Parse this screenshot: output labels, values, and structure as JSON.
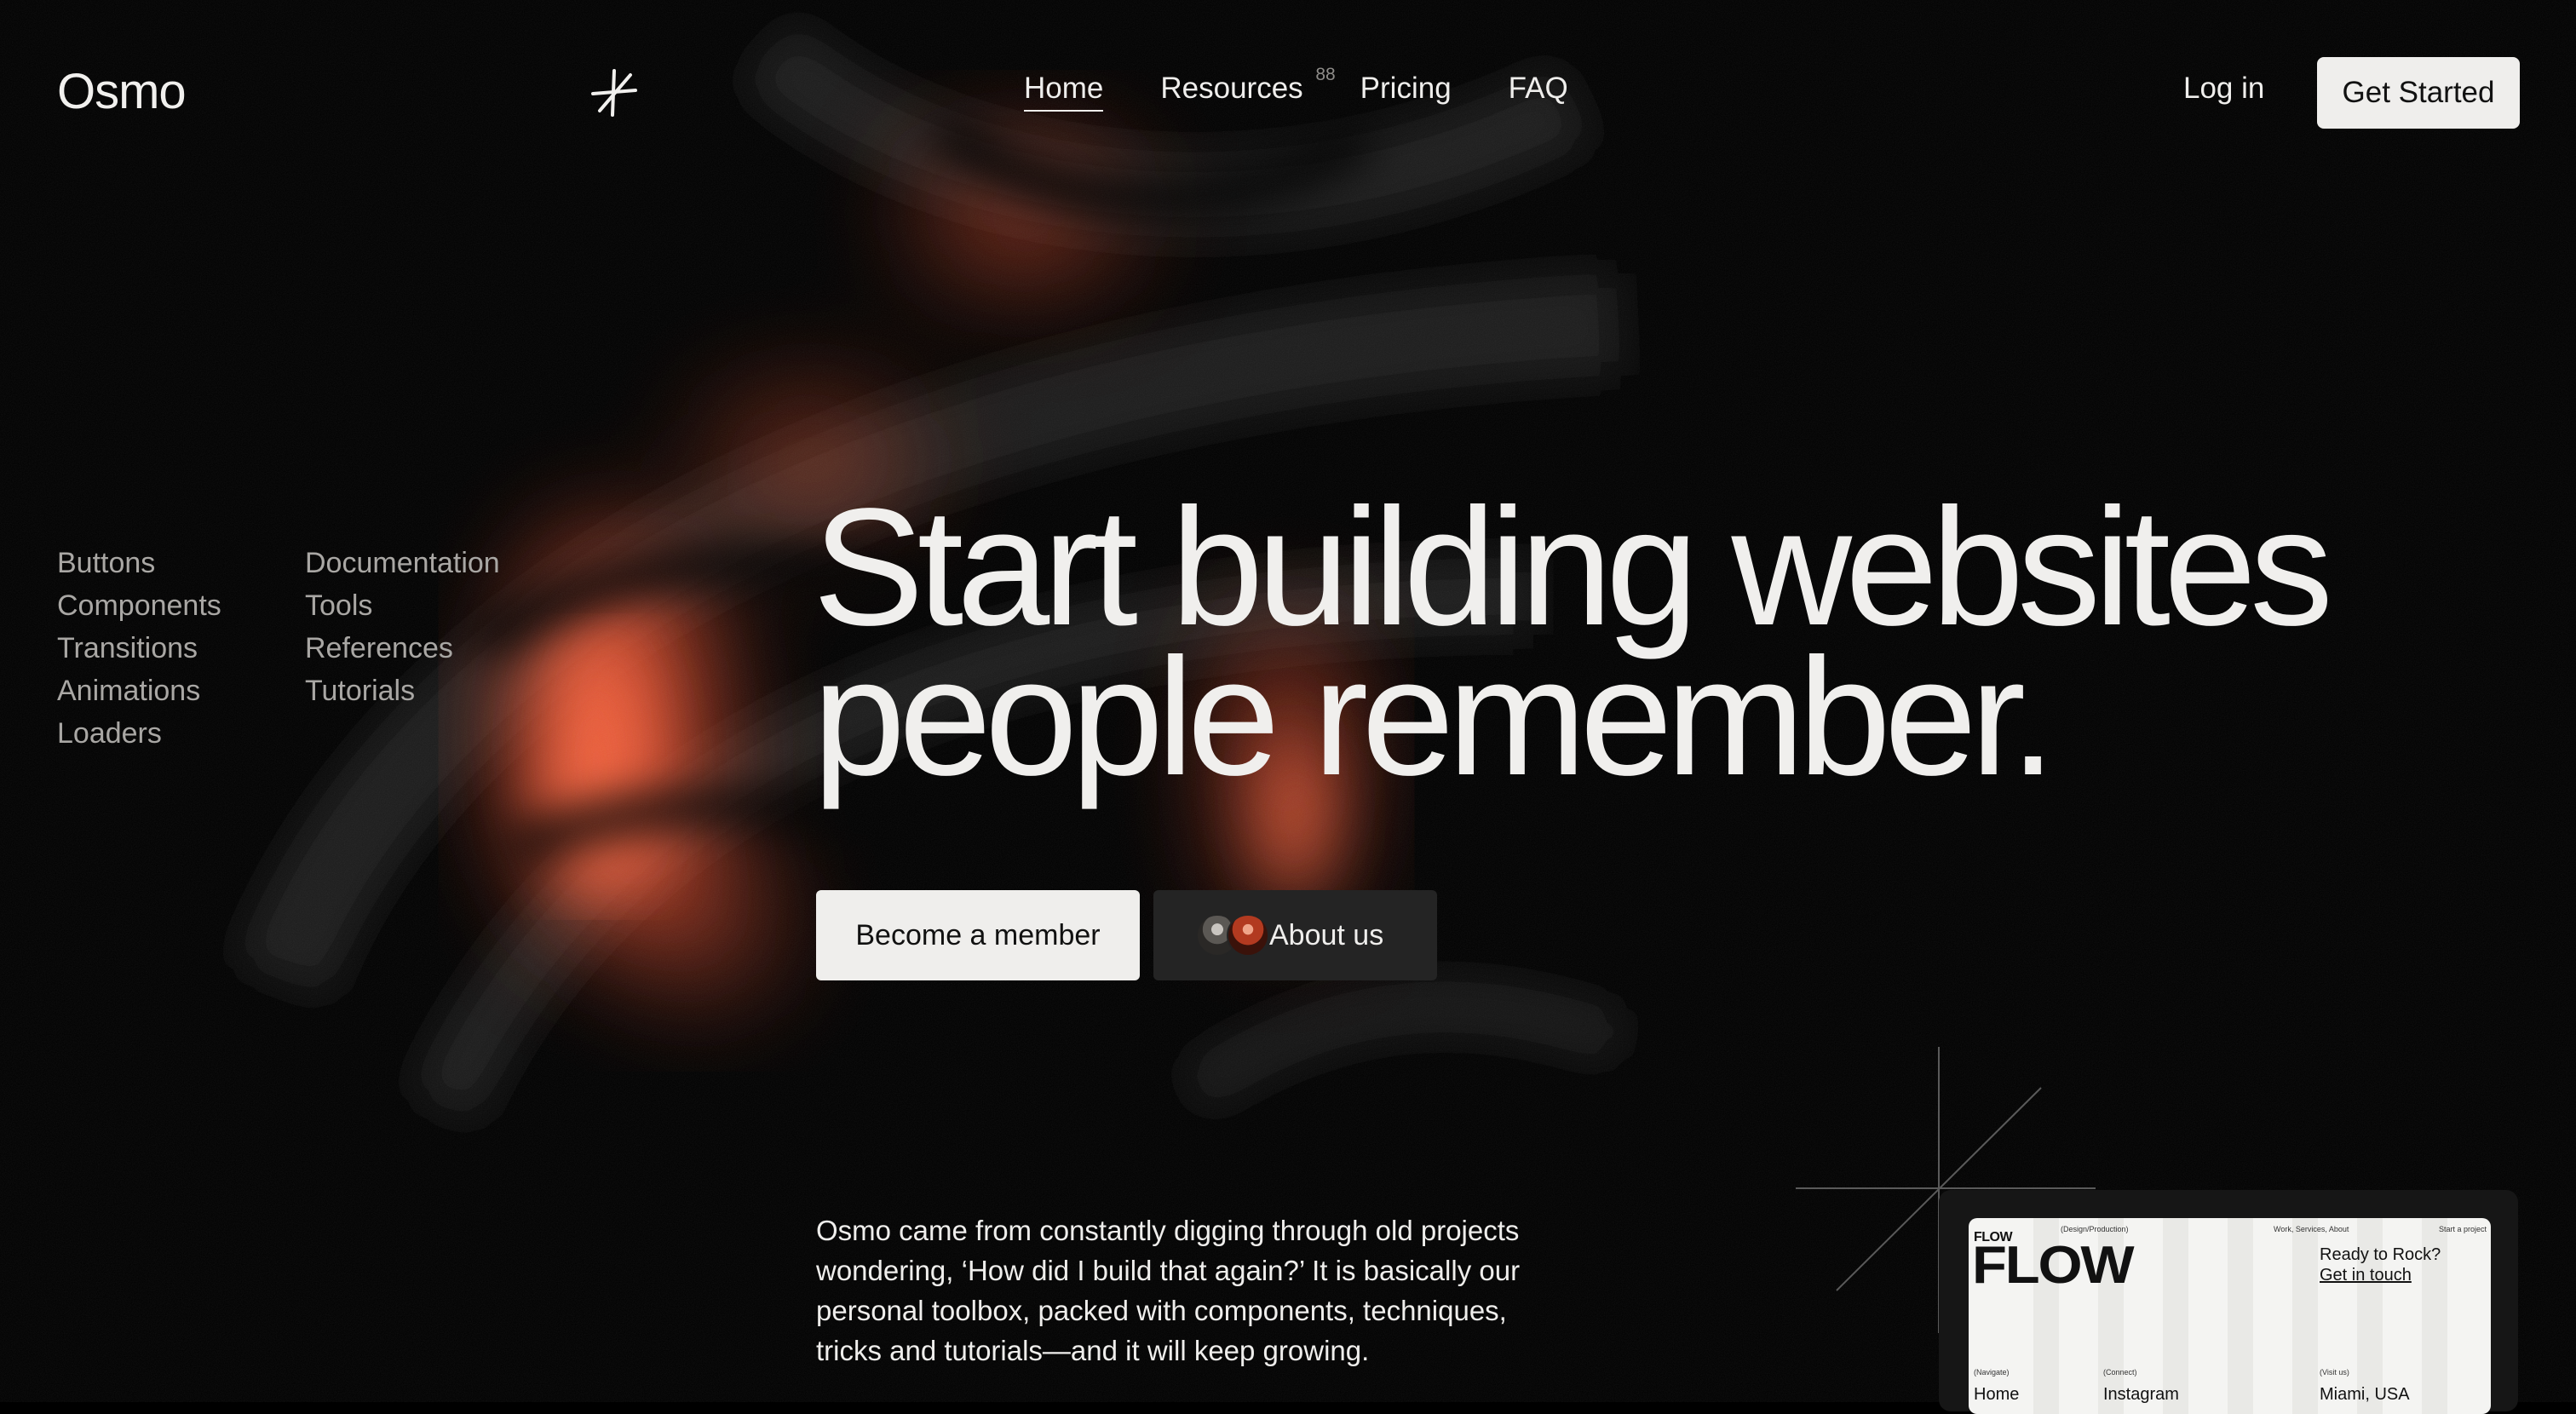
{
  "brand": {
    "name": "Osmo"
  },
  "nav": {
    "items": [
      {
        "label": "Home",
        "active": true
      },
      {
        "label": "Resources",
        "badge": "88"
      },
      {
        "label": "Pricing"
      },
      {
        "label": "FAQ"
      }
    ],
    "login_label": "Log in",
    "get_started_label": "Get Started"
  },
  "sidebar": {
    "col1": [
      "Buttons",
      "Components",
      "Transitions",
      "Animations",
      "Loaders"
    ],
    "col2": [
      "Documentation",
      "Tools",
      "References",
      "Tutorials"
    ]
  },
  "hero": {
    "headline_line1": "Start building websites",
    "headline_line2": "people remember.",
    "primary_cta": "Become a member",
    "secondary_cta": "About us",
    "description": "Osmo came from constantly digging through old projects wondering, ‘How did I build that again?’ It is basically our personal toolbox, packed with components, techniques, tricks and tutorials—and it will keep growing."
  },
  "preview": {
    "logo_small": "FLOW",
    "tag_design": "(Design/Production)",
    "tag_work": "Work, Services, About",
    "tag_start": "Start a project",
    "big_logo": "FLOW",
    "ready": "Ready to Rock?",
    "get_in_touch": "Get in touch",
    "label_navigate": "(Navigate)",
    "label_connect": "(Connect)",
    "label_visit": "(Visit us)",
    "link_home": "Home",
    "link_instagram": "Instagram",
    "link_location": "Miami, USA"
  },
  "colors": {
    "background": "#000000",
    "accent": "#ff5a36",
    "text": "#efeeec",
    "button_light": "#efeeec",
    "button_dark": "#242424"
  },
  "icons": [
    "asterisk-logo-icon",
    "avatar-group"
  ]
}
